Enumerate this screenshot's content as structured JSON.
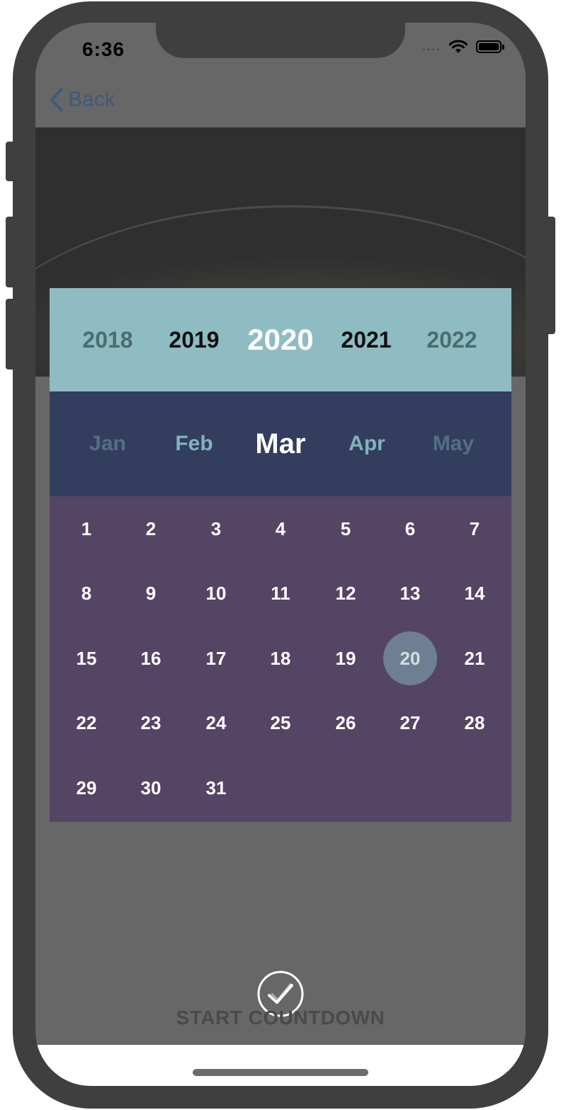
{
  "status_bar": {
    "time": "6:36",
    "signal_dots": "....",
    "wifi_icon": "wifi-icon",
    "battery_icon": "battery-icon"
  },
  "nav": {
    "back_label": "Back",
    "back_icon": "chevron-left-icon"
  },
  "date_picker": {
    "years": [
      {
        "label": "2018",
        "state": "fade"
      },
      {
        "label": "2019",
        "state": "normal"
      },
      {
        "label": "2020",
        "state": "selected"
      },
      {
        "label": "2021",
        "state": "normal"
      },
      {
        "label": "2022",
        "state": "fade"
      }
    ],
    "months": [
      {
        "label": "Jan",
        "state": "fade"
      },
      {
        "label": "Feb",
        "state": "normal"
      },
      {
        "label": "Mar",
        "state": "selected"
      },
      {
        "label": "Apr",
        "state": "normal"
      },
      {
        "label": "May",
        "state": "fade"
      }
    ],
    "days": [
      "1",
      "2",
      "3",
      "4",
      "5",
      "6",
      "7",
      "8",
      "9",
      "10",
      "11",
      "12",
      "13",
      "14",
      "15",
      "16",
      "17",
      "18",
      "19",
      "20",
      "21",
      "22",
      "23",
      "24",
      "25",
      "26",
      "27",
      "28",
      "29",
      "30",
      "31"
    ],
    "selected_day": "20"
  },
  "action": {
    "label": "START COUNTDOWN",
    "icon": "checkmark-circle-icon"
  },
  "colors": {
    "year_strip": "#8ebcc2",
    "month_strip": "#333d5e",
    "day_grid": "#544565",
    "selected_day_bg": "#6e7f93",
    "back_link": "#3f5a7a"
  }
}
